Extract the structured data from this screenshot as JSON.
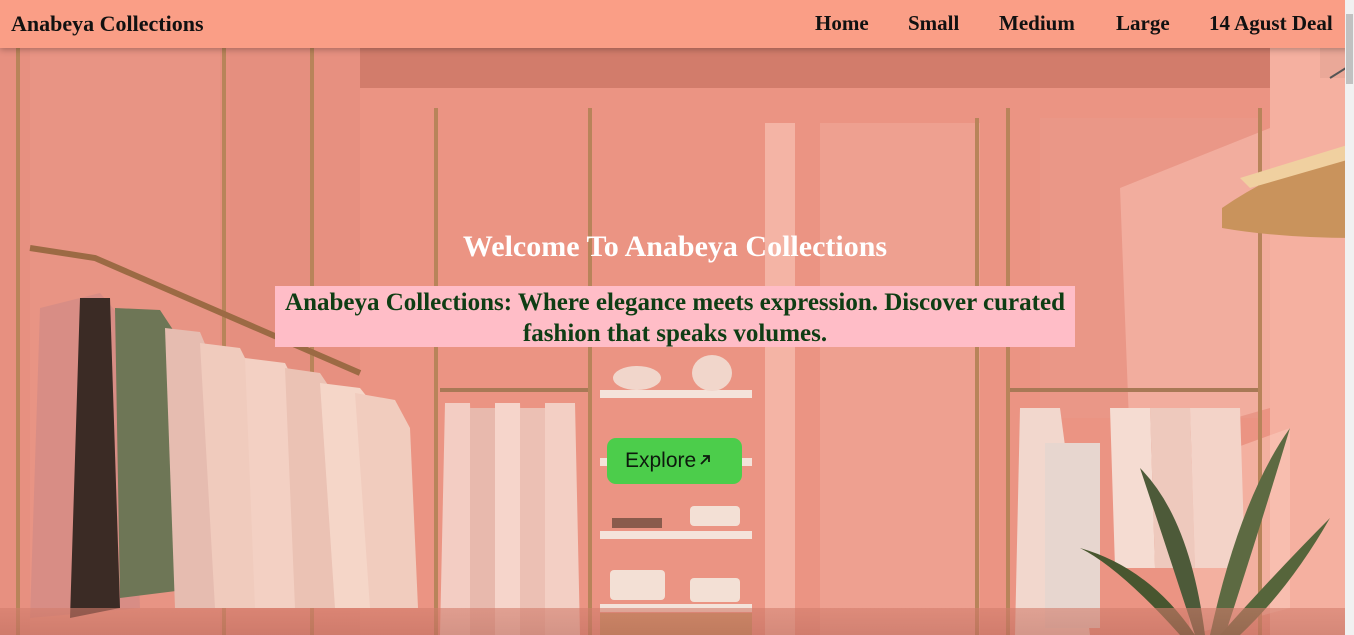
{
  "nav": {
    "brand": "Anabeya Collections",
    "links": [
      "Home",
      "Small",
      "Medium",
      "Large",
      "14 Agust Deal"
    ]
  },
  "hero": {
    "headline": "Welcome To Anabeya Collections",
    "tagline": "Anabeya Collections: Where elegance meets expression. Discover curated fashion that speaks volumes.",
    "explore_label": "Explore",
    "explore_icon": "arrow-up-right-icon",
    "image_subject": "pink clothing boutique interior with garment racks, shelves and plant"
  },
  "colors": {
    "navbar": "#fa9e86",
    "tagline_bg": "#ffbdc7",
    "tagline_text": "#0f3d14",
    "button": "#4ccd4b"
  }
}
